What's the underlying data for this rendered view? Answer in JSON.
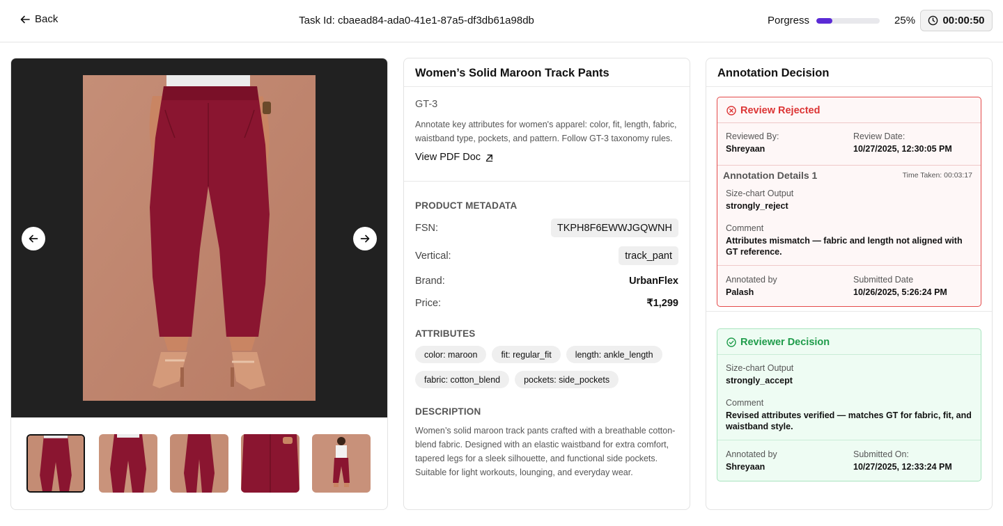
{
  "header": {
    "back_label": "Back",
    "task_id": "Task Id: cbaead84-ada0-41e1-87a5-df3db61a98db",
    "progress_label": "Porgress",
    "progress_value": 0.25,
    "progress_percent_text": "25%",
    "timer": "00:00:50"
  },
  "product_card": {
    "title": "Women’s Solid Maroon Track Pants",
    "gt_code": "GT-3",
    "gt_description": "Annotate key attributes for women's apparel: color, fit, length, fabric, waistband type, pockets, and pattern. Follow GT-3 taxonomy rules.",
    "pdf_link": "View PDF Doc",
    "metadata_heading": "PRODUCT METADATA",
    "metadata": [
      {
        "label": "FSN:",
        "value": "TKPH8F6EWWJGQWNH",
        "style": "chip"
      },
      {
        "label": "Vertical:",
        "value": "track_pant",
        "style": "chip"
      },
      {
        "label": "Brand:",
        "value": "UrbanFlex",
        "style": "bold"
      },
      {
        "label": "Price:",
        "value": "₹1,299",
        "style": "bold"
      }
    ],
    "attributes_heading": "ATTRIBUTES",
    "attributes": [
      "color: maroon",
      "fit: regular_fit",
      "length: ankle_length",
      "fabric: cotton_blend",
      "pockets: side_pockets"
    ],
    "description_heading": "DESCRIPTION",
    "description": "Women’s solid maroon track pants crafted with a breathable cotton-blend fabric. Designed with an elastic waistband for extra comfort, tapered legs for a sleek silhouette, and functional side pockets. Suitable for light workouts, lounging, and everyday wear."
  },
  "gallery": {
    "thumbnail_count": 5,
    "active_index": 0,
    "colors": {
      "background": "#212121",
      "photo_backdrop": "#c48c74",
      "pants": "#8a1530"
    }
  },
  "annotation": {
    "title": "Annotation Decision",
    "review": {
      "status": "Review Rejected",
      "reviewed_by_label": "Reviewed By:",
      "reviewed_by": "Shreyaan",
      "review_date_label": "Review Date:",
      "review_date": "10/27/2025, 12:30:05 PM",
      "details_heading": "Annotation Details 1",
      "time_taken": "Time Taken: 00:03:17",
      "output_label": "Size-chart Output",
      "output": "strongly_reject",
      "comment_label": "Comment",
      "comment": "Attributes mismatch — fabric and length not aligned with GT reference.",
      "annotated_by_label": "Annotated by",
      "annotated_by": "Palash",
      "submitted_label": "Submitted Date",
      "submitted": "10/26/2025, 5:26:24 PM"
    },
    "reviewer_decision": {
      "status": "Reviewer Decision",
      "output_label": "Size-chart Output",
      "output": "strongly_accept",
      "comment_label": "Comment",
      "comment": "Revised attributes verified — matches GT for fabric, fit, and waistband style.",
      "annotated_by_label": "Annotated by",
      "annotated_by": "Shreyaan",
      "submitted_label": "Submitted On:",
      "submitted": "10/27/2025, 12:33:24 PM"
    }
  },
  "colors": {
    "accent": "#5b2bd6",
    "rejected": "#dc3535",
    "accepted": "#1f9c4b"
  }
}
